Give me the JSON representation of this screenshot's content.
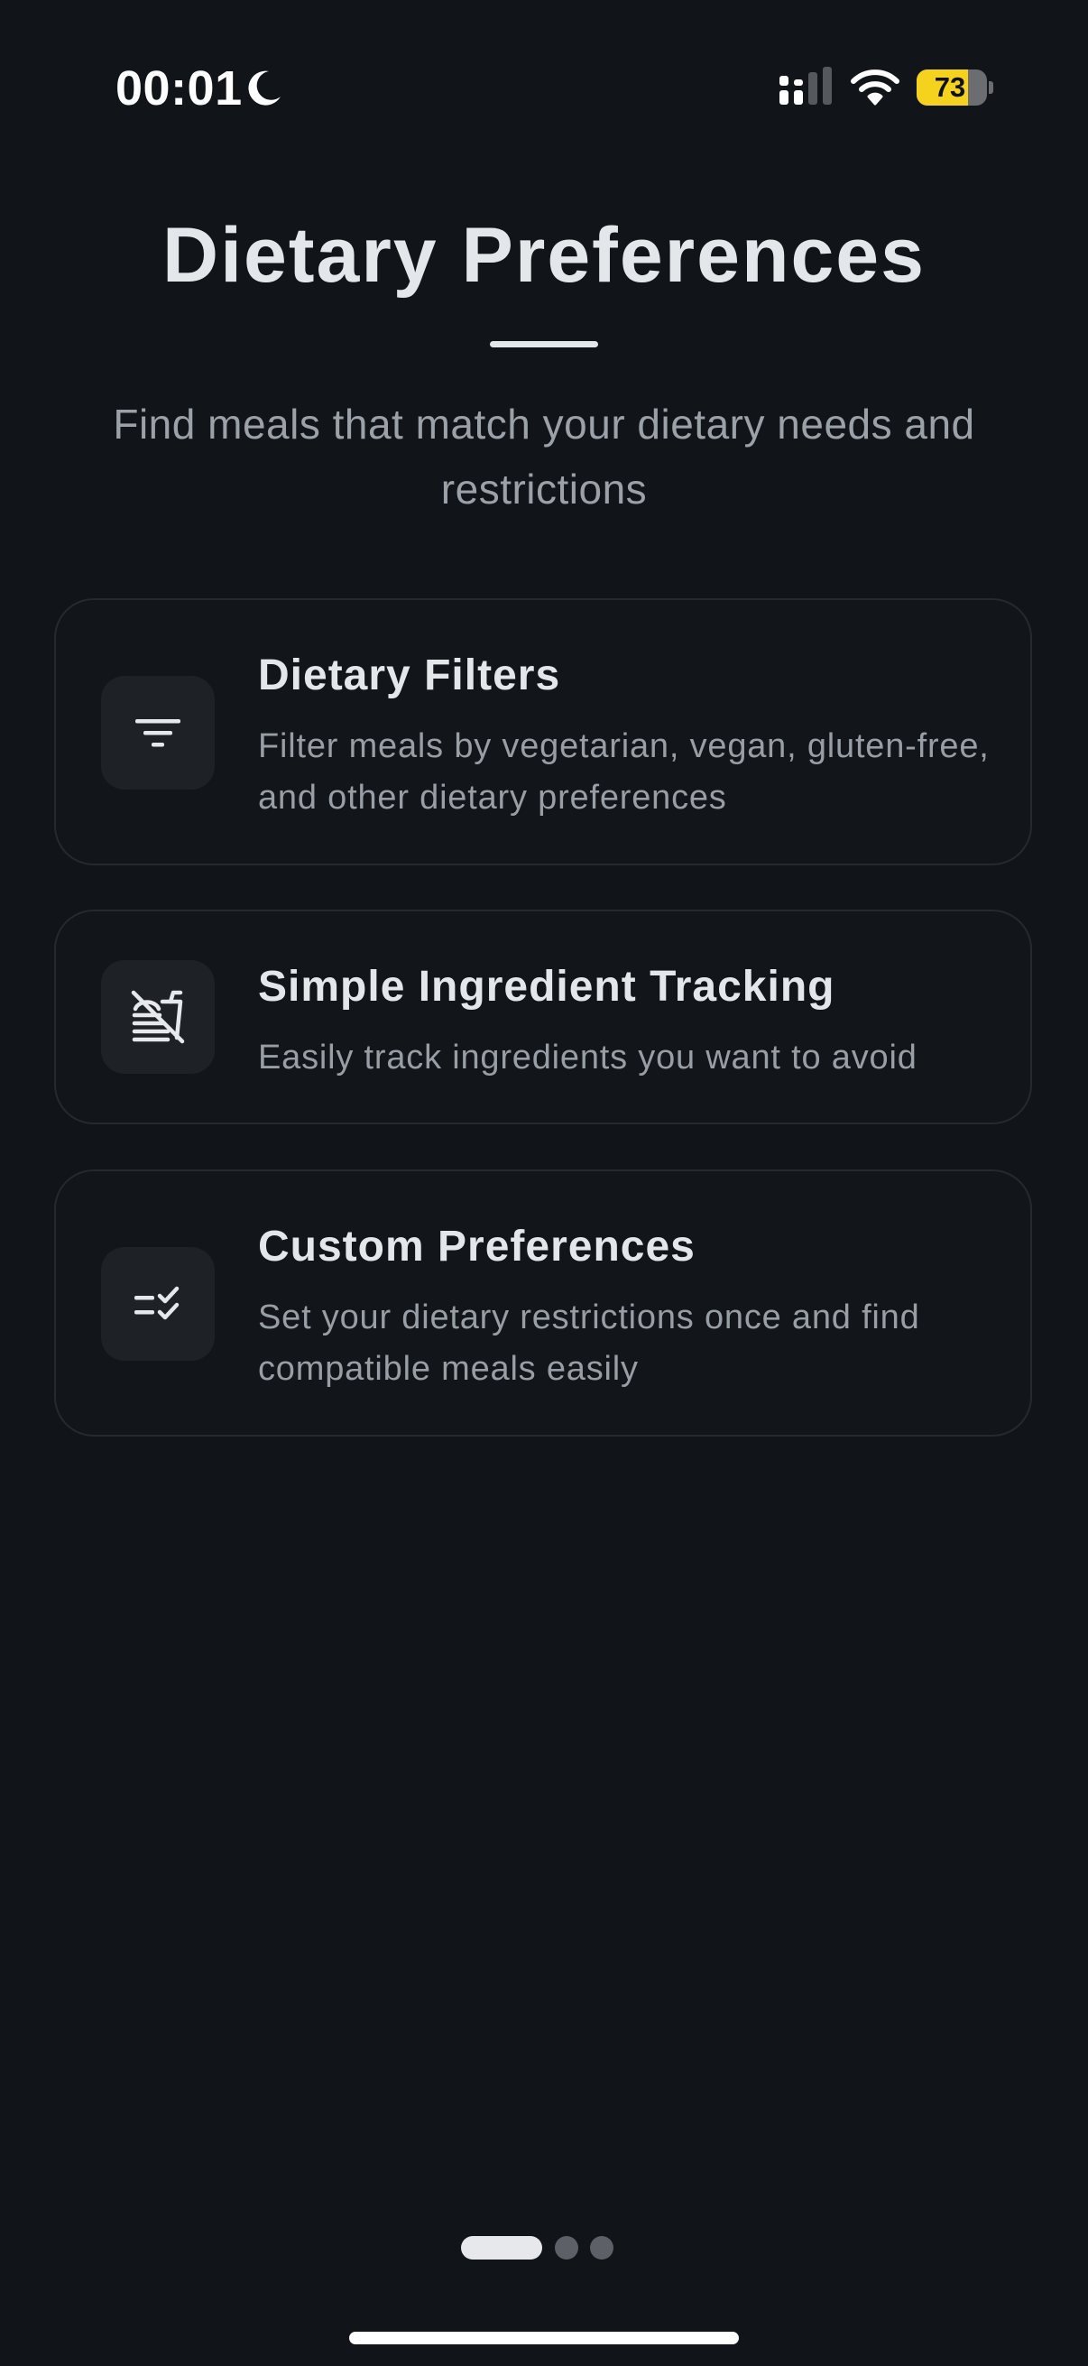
{
  "status_bar": {
    "time": "00:01",
    "battery_level": "73",
    "battery_fraction": 0.73,
    "icons": [
      "moon-icon",
      "signal-icon",
      "wifi-icon",
      "battery-icon"
    ]
  },
  "header": {
    "title": "Dietary Preferences",
    "subtitle": "Find meals that match your dietary needs and restrictions"
  },
  "features": [
    {
      "icon": "filter-icon",
      "title": "Dietary Filters",
      "description": "Filter meals by vegetarian, vegan, gluten-free, and other dietary preferences"
    },
    {
      "icon": "no-food-icon",
      "title": "Simple Ingredient Tracking",
      "description": "Easily track ingredients you want to avoid"
    },
    {
      "icon": "checklist-icon",
      "title": "Custom Preferences",
      "description": "Set your dietary restrictions once and find compatible meals easily"
    }
  ],
  "pagination": {
    "current_page": 1,
    "total_pages": 3
  },
  "colors": {
    "background": "#111418",
    "card_border": "#262a30",
    "icon_box": "#1e2125",
    "title_text": "#e4e7ea",
    "secondary_text": "#989ea5",
    "battery_accent": "#f5d21d"
  }
}
